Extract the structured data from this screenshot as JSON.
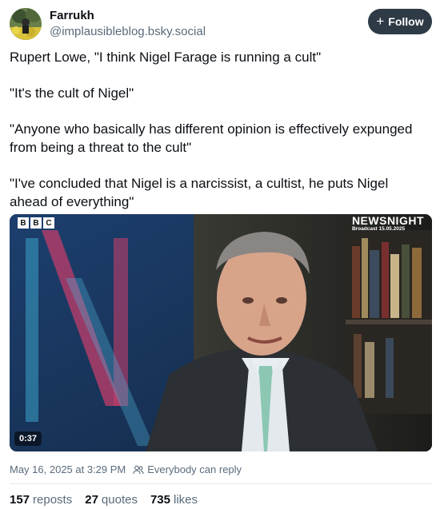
{
  "author": {
    "display_name": "Farrukh",
    "handle": "@implausibleblog.bsky.social",
    "avatar_icon": "avatar-image"
  },
  "follow_button": {
    "label": "Follow",
    "icon": "plus-icon"
  },
  "post": {
    "paragraphs": [
      "Rupert Lowe, \"I think Nigel Farage is running a cult\"",
      "\"It's the cult of Nigel\"",
      "\"Anyone who basically has different opinion is effectively expunged from being a threat to the cult\"",
      "\"I've concluded that Nigel is a narcissist, a cultist, he puts Nigel ahead of everything\""
    ]
  },
  "media": {
    "broadcaster_logo": [
      "B",
      "B",
      "C"
    ],
    "programme": "NEWSNIGHT",
    "broadcast_date": "Broadcast 15.05.2025",
    "duration": "0:37"
  },
  "meta": {
    "timestamp": "May 16, 2025 at 3:29 PM",
    "reply_setting": "Everybody can reply",
    "reply_icon": "people-icon"
  },
  "stats": {
    "reposts_count": "157",
    "reposts_label": "reposts",
    "quotes_count": "27",
    "quotes_label": "quotes",
    "likes_count": "735",
    "likes_label": "likes"
  },
  "colors": {
    "follow_bg": "#2e3a46",
    "muted_text": "#5a6b7b",
    "text": "#0b0f14"
  }
}
